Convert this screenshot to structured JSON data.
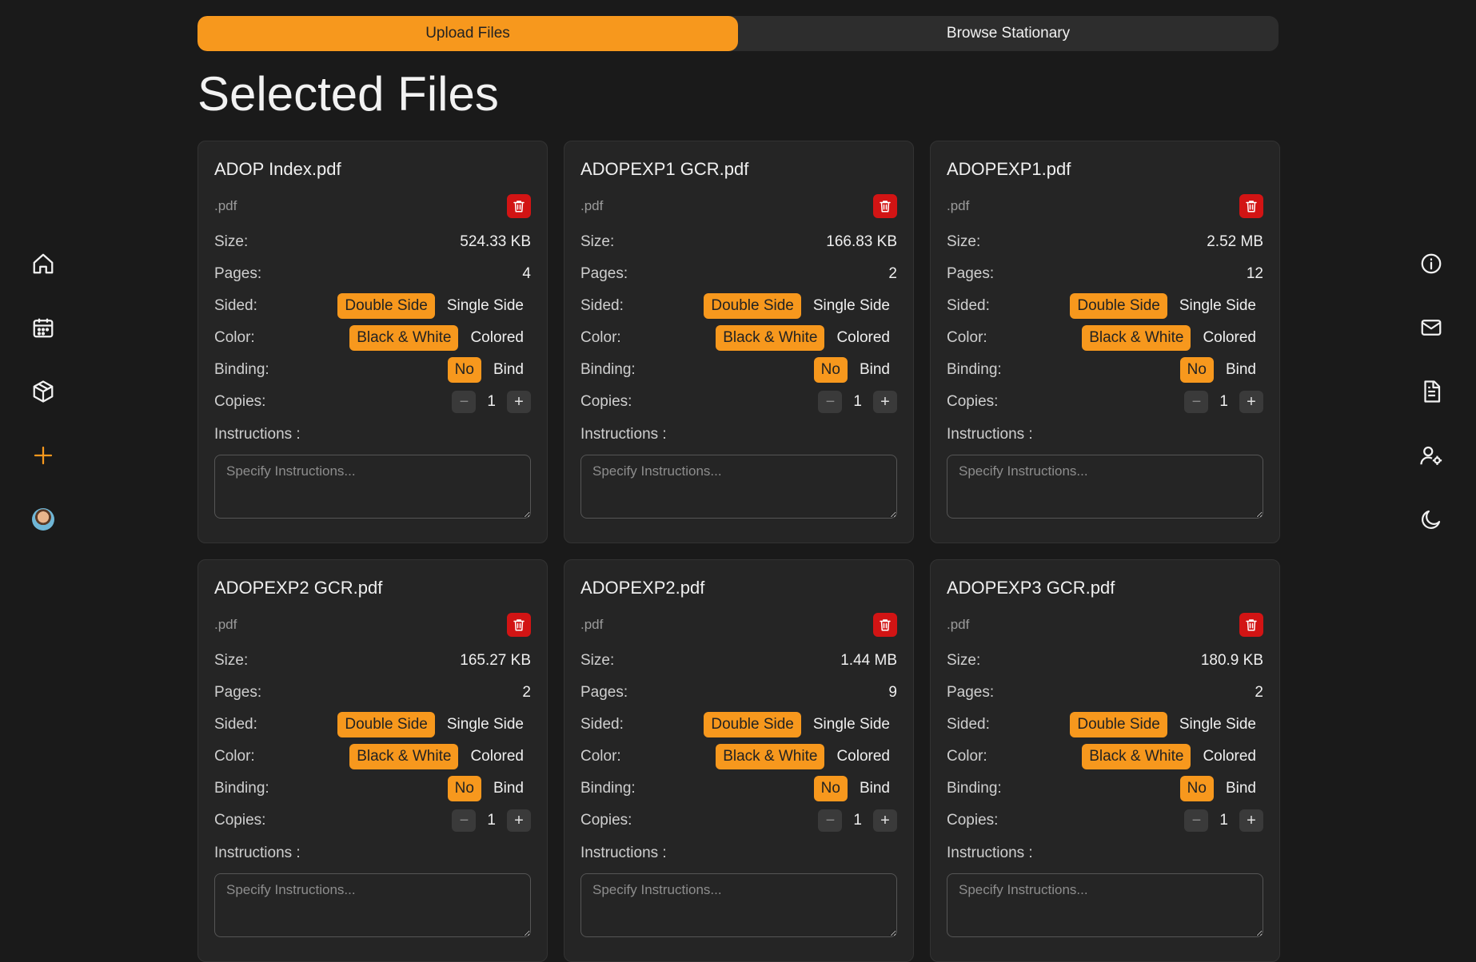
{
  "tabs": [
    {
      "label": "Upload Files",
      "active": true
    },
    {
      "label": "Browse Stationary",
      "active": false
    }
  ],
  "page_title": "Selected Files",
  "sidebar_left": [
    "home-icon",
    "calendar-icon",
    "package-icon",
    "plus-icon",
    "avatar"
  ],
  "sidebar_right": [
    "info-icon",
    "mail-icon",
    "document-icon",
    "user-settings-icon",
    "moon-icon"
  ],
  "labels": {
    "size": "Size:",
    "pages": "Pages:",
    "sided": "Sided:",
    "color": "Color:",
    "binding": "Binding:",
    "copies": "Copies:",
    "instructions": "Instructions :",
    "double_side": "Double Side",
    "single_side": "Single Side",
    "bw": "Black & White",
    "colored": "Colored",
    "no": "No",
    "bind": "Bind",
    "minus": "−",
    "plus": "+",
    "placeholder": "Specify Instructions..."
  },
  "files": [
    {
      "name": "ADOP Index.pdf",
      "ext": ".pdf",
      "size": "524.33 KB",
      "pages": "4",
      "copies": "1"
    },
    {
      "name": "ADOPEXP1 GCR.pdf",
      "ext": ".pdf",
      "size": "166.83 KB",
      "pages": "2",
      "copies": "1"
    },
    {
      "name": "ADOPEXP1.pdf",
      "ext": ".pdf",
      "size": "2.52 MB",
      "pages": "12",
      "copies": "1"
    },
    {
      "name": "ADOPEXP2 GCR.pdf",
      "ext": ".pdf",
      "size": "165.27 KB",
      "pages": "2",
      "copies": "1"
    },
    {
      "name": "ADOPEXP2.pdf",
      "ext": ".pdf",
      "size": "1.44 MB",
      "pages": "9",
      "copies": "1"
    },
    {
      "name": "ADOPEXP3 GCR.pdf",
      "ext": ".pdf",
      "size": "180.9 KB",
      "pages": "2",
      "copies": "1"
    }
  ],
  "colors": {
    "accent": "#f7981d",
    "danger": "#d21414",
    "background": "#1a1a1a",
    "card": "#252525"
  }
}
